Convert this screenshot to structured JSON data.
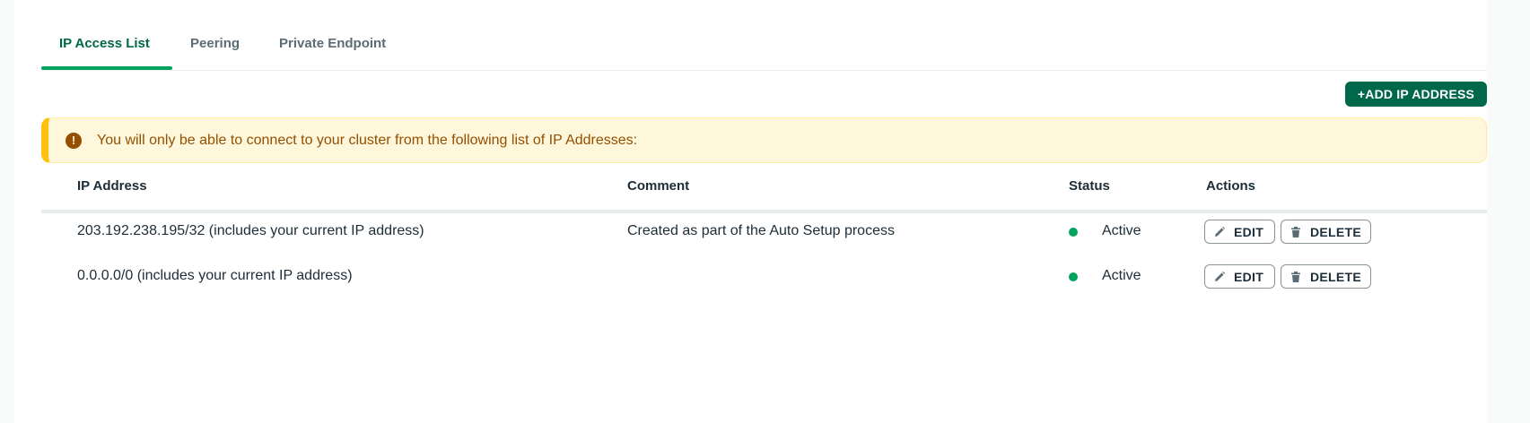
{
  "tabs": [
    {
      "label": "IP Access List",
      "active": true
    },
    {
      "label": "Peering",
      "active": false
    },
    {
      "label": "Private Endpoint",
      "active": false
    }
  ],
  "add_button": {
    "label": "+ADD IP ADDRESS"
  },
  "banner": {
    "icon": "warning-icon",
    "glyph": "!",
    "text": "You will only be able to connect to your cluster from the following list of IP Addresses:"
  },
  "table": {
    "headers": {
      "ip": "IP Address",
      "comment": "Comment",
      "status": "Status",
      "actions": "Actions"
    },
    "rows": [
      {
        "ip": "203.192.238.195/32 (includes your current IP address)",
        "comment": "Created as part of the Auto Setup process",
        "status": "Active",
        "edit_label": "EDIT",
        "delete_label": "DELETE"
      },
      {
        "ip": "0.0.0.0/0 (includes your current IP address)",
        "comment": "",
        "status": "Active",
        "edit_label": "EDIT",
        "delete_label": "DELETE"
      }
    ]
  },
  "colors": {
    "brand_green": "#00684a",
    "accent_green": "#00a35c",
    "warning_bg": "#fef7db",
    "warning_border": "#ffc010",
    "warning_text": "#944f01"
  }
}
